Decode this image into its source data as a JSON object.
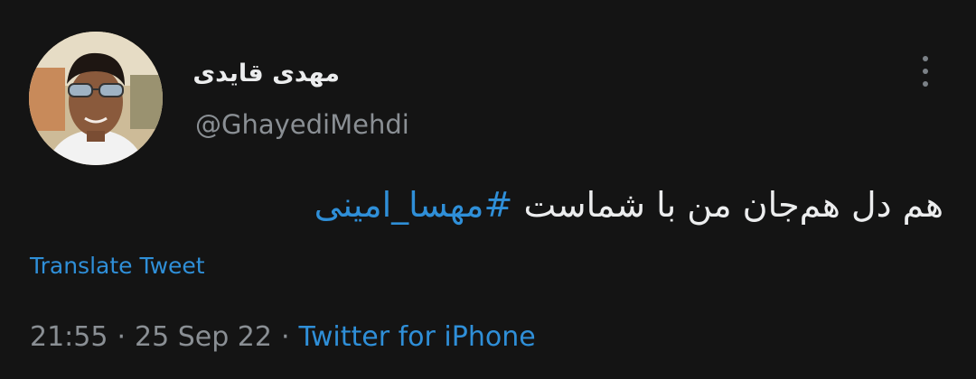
{
  "user": {
    "display_name": "مهدی قایدی",
    "handle": "@GhayediMehdi",
    "avatar_icon": "avatar-photo"
  },
  "tweet": {
    "text_plain": "هم دل هم‌جان من با شماست ",
    "hashtag": "#مهسا_امینی"
  },
  "actions": {
    "more_icon": "more-vertical-icon",
    "translate_label": "Translate Tweet"
  },
  "meta": {
    "time": "21:55",
    "separator": "·",
    "date": "25 Sep 22",
    "source": "Twitter for iPhone"
  },
  "colors": {
    "background": "#141414",
    "text_primary": "#ecedee",
    "text_secondary": "#8a8f94",
    "accent": "#2f8fd8"
  }
}
